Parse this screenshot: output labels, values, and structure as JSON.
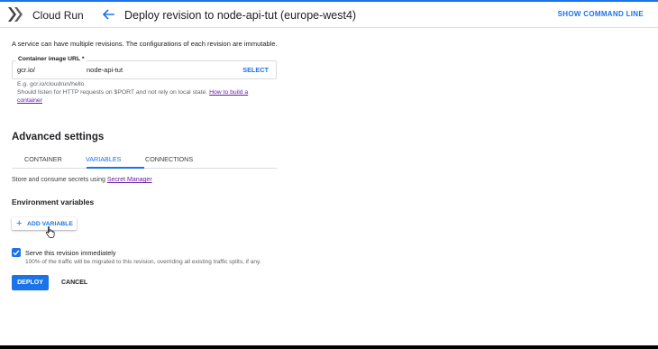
{
  "header": {
    "app_name": "Cloud Run",
    "page_title": "Deploy revision to node-api-tut (europe-west4)",
    "show_command_line": "SHOW COMMAND LINE"
  },
  "intro": "A service can have multiple revisions. The configurations of each revision are immutable.",
  "container_image": {
    "label": "Container image URL *",
    "prefix": "gcr.io/",
    "value": "node-api-tut",
    "select_label": "SELECT",
    "hint_example": "E.g. gcr.io/cloudrun/hello",
    "hint_text": "Should listen for HTTP requests on $PORT and not rely on local state.",
    "hint_link_part1": "How to build a",
    "hint_link_part2": "container"
  },
  "advanced": {
    "title": "Advanced settings",
    "tabs": [
      {
        "label": "CONTAINER"
      },
      {
        "label": "VARIABLES",
        "active": true
      },
      {
        "label": "CONNECTIONS"
      }
    ]
  },
  "secrets": {
    "text": "Store and consume secrets using",
    "link": "Secret Manager"
  },
  "env": {
    "title": "Environment variables",
    "add_label": "ADD VARIABLE"
  },
  "serve": {
    "checked": true,
    "label": "Serve this revision immediately",
    "sub": "100% of the traffic will be migrated to this revision, overriding all existing traffic splits, if any."
  },
  "actions": {
    "deploy": "DEPLOY",
    "cancel": "CANCEL"
  },
  "colors": {
    "accent": "#1a73e8",
    "link": "#681da8"
  }
}
